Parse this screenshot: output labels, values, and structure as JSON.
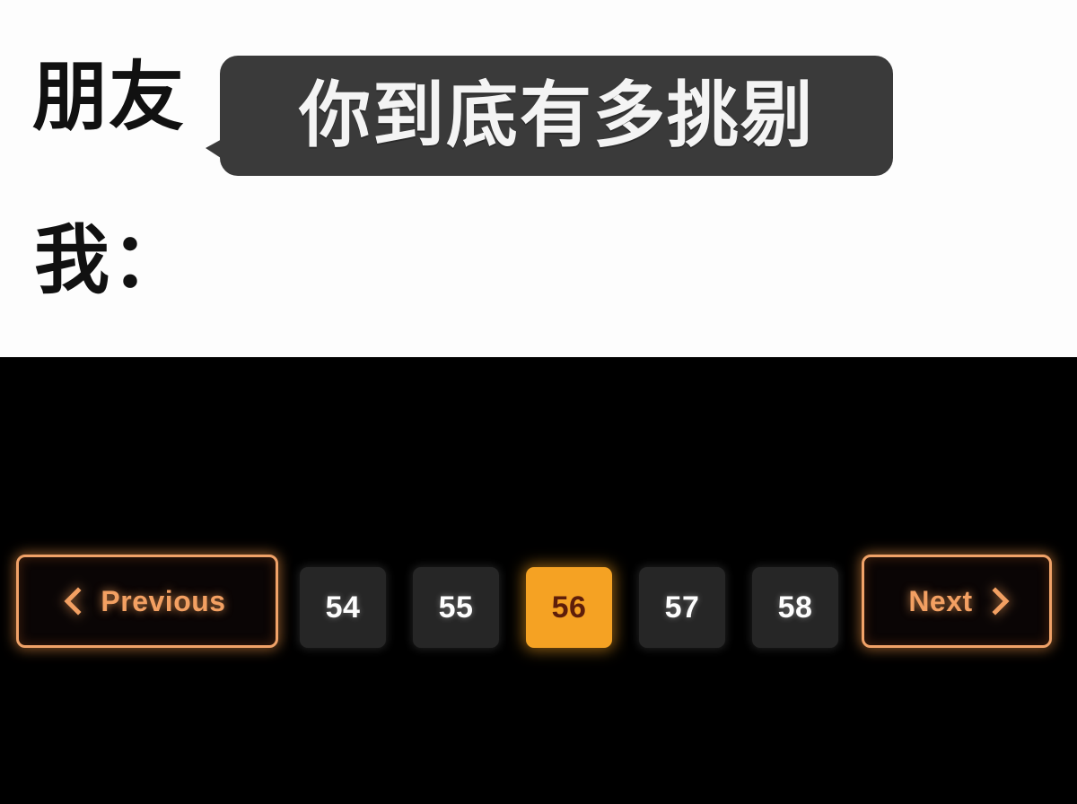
{
  "meme": {
    "friend_label": "朋友",
    "bubble_text": "你到底有多挑剔",
    "me_label": "我："
  },
  "app": {
    "theme": {
      "background": "#000000",
      "accent": "#f5a223",
      "accent_glow": "#f0a268",
      "button_bg": "#262626",
      "active_text": "#5e1e0a",
      "number_text": "#fdfdfd"
    },
    "pagination": {
      "previous_label": "Previous",
      "next_label": "Next",
      "previous_icon": "chevron-left-icon",
      "next_icon": "chevron-right-icon",
      "current_page": 56,
      "pages": [
        {
          "label": "54",
          "active": false
        },
        {
          "label": "55",
          "active": false
        },
        {
          "label": "56",
          "active": true
        },
        {
          "label": "57",
          "active": false
        },
        {
          "label": "58",
          "active": false
        }
      ]
    }
  }
}
